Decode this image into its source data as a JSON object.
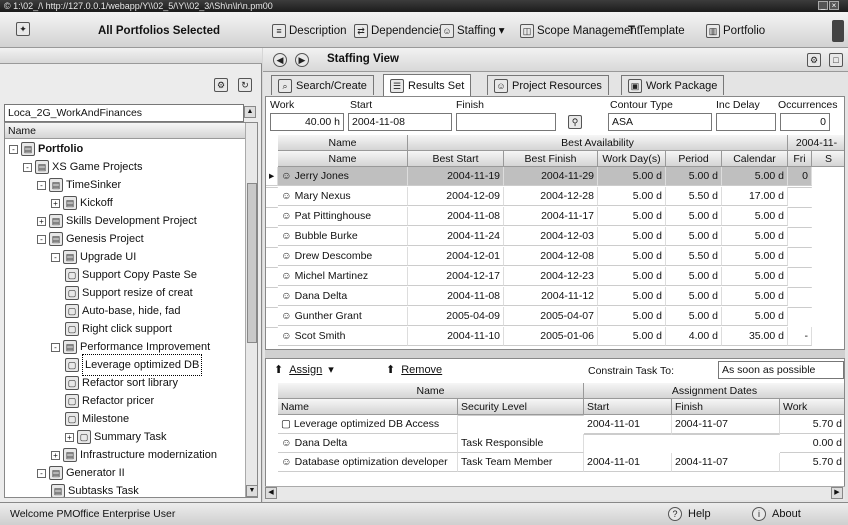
{
  "window": {
    "title": "© 1:\\02_/\\ http://127.0.0.1/webapp/Y\\\\02_5/\\Y\\\\02_3/\\Sh\\n\\lr\\n.pm00"
  },
  "toolbar": {
    "selection_label": "All Portfolios Selected",
    "items": [
      "Description",
      "Dependencies",
      "Staffing",
      "Scope Management",
      "Template",
      "Portfolio"
    ]
  },
  "left": {
    "location_value": "Loca_2G_WorkAndFinances",
    "column_header": "Name",
    "tree": [
      {
        "label": "Portfolio",
        "depth": 0,
        "expander": "-"
      },
      {
        "label": "XS Game Projects",
        "depth": 1,
        "expander": "-"
      },
      {
        "label": "TimeSinker",
        "depth": 2,
        "expander": "-"
      },
      {
        "label": "Kickoff",
        "depth": 3,
        "expander": "+"
      },
      {
        "label": "Skills Development Project",
        "depth": 2,
        "expander": "+"
      },
      {
        "label": "Genesis Project",
        "depth": 2,
        "expander": "-"
      },
      {
        "label": "Upgrade UI",
        "depth": 3,
        "expander": "-"
      },
      {
        "label": "Support Copy Paste Se",
        "depth": 4,
        "expander": ""
      },
      {
        "label": "Support resize of creat",
        "depth": 4,
        "expander": ""
      },
      {
        "label": "Auto-base, hide, fad",
        "depth": 4,
        "expander": ""
      },
      {
        "label": "Right click support",
        "depth": 4,
        "expander": ""
      },
      {
        "label": "Performance Improvement",
        "depth": 3,
        "expander": "-"
      },
      {
        "label": "Leverage optimized DB",
        "depth": 4,
        "expander": "",
        "selected": true
      },
      {
        "label": "Refactor sort library",
        "depth": 4,
        "expander": ""
      },
      {
        "label": "Refactor pricer",
        "depth": 4,
        "expander": ""
      },
      {
        "label": "Milestone",
        "depth": 4,
        "expander": ""
      },
      {
        "label": "Summary Task",
        "depth": 4,
        "expander": "+"
      },
      {
        "label": "Infrastructure modernization",
        "depth": 3,
        "expander": "+"
      },
      {
        "label": "Generator II",
        "depth": 2,
        "expander": "-"
      },
      {
        "label": "Subtasks Task",
        "depth": 3,
        "expander": ""
      }
    ]
  },
  "right": {
    "view_title": "Staffing View",
    "tabs": [
      "Search/Create",
      "Results Set",
      "Project Resources",
      "Work Package"
    ],
    "filters": {
      "work_label": "Work",
      "work_value": "40.00 h",
      "start_label": "Start",
      "start_value": "2004-11-08",
      "finish_label": "Finish",
      "finish_value": "",
      "contour_label": "Contour Type",
      "contour_value": "ASA",
      "inc_delay_label": "Inc Delay",
      "inc_delay_value": "",
      "occurrences_label": "Occurrences",
      "occurrences_value": "0"
    },
    "results": {
      "group_headers": [
        "Name",
        "Best Availability",
        "2004-11-"
      ],
      "columns": [
        "Name",
        "Best Start",
        "Best Finish",
        "Work Day(s)",
        "Period",
        "Calendar",
        "Fri",
        "S"
      ],
      "rows": [
        {
          "name": "Jerry Jones",
          "start": "2004-11-19",
          "finish": "2004-11-29",
          "work": "5.00 d",
          "period": "5.00 d",
          "calendar": "5.00 d",
          "fri": "0",
          "selected": true
        },
        {
          "name": "Mary Nexus",
          "start": "2004-12-09",
          "finish": "2004-12-28",
          "work": "5.00 d",
          "period": "5.50 d",
          "calendar": "17.00 d",
          "fri": ""
        },
        {
          "name": "Pat Pittinghouse",
          "start": "2004-11-08",
          "finish": "2004-11-17",
          "work": "5.00 d",
          "period": "5.00 d",
          "calendar": "5.00 d",
          "fri": ""
        },
        {
          "name": "Bubble Burke",
          "start": "2004-11-24",
          "finish": "2004-12-03",
          "work": "5.00 d",
          "period": "5.00 d",
          "calendar": "5.00 d",
          "fri": ""
        },
        {
          "name": "Drew Descombe",
          "start": "2004-12-01",
          "finish": "2004-12-08",
          "work": "5.00 d",
          "period": "5.50 d",
          "calendar": "5.00 d",
          "fri": ""
        },
        {
          "name": "Michel Martinez",
          "start": "2004-12-17",
          "finish": "2004-12-23",
          "work": "5.00 d",
          "period": "5.00 d",
          "calendar": "5.00 d",
          "fri": ""
        },
        {
          "name": "Dana Delta",
          "start": "2004-11-08",
          "finish": "2004-11-12",
          "work": "5.00 d",
          "period": "5.00 d",
          "calendar": "5.00 d",
          "fri": ""
        },
        {
          "name": "Gunther Grant",
          "start": "2005-04-09",
          "finish": "2005-04-07",
          "work": "5.00 d",
          "period": "5.00 d",
          "calendar": "5.00 d",
          "fri": ""
        },
        {
          "name": "Scot Smith",
          "start": "2004-11-10",
          "finish": "2005-01-06",
          "work": "5.00 d",
          "period": "4.00 d",
          "calendar": "35.00 d",
          "fri": "-"
        }
      ]
    },
    "assign": {
      "assign_label": "Assign",
      "remove_label": "Remove",
      "constrain_label": "Constrain Task To:",
      "constrain_value": "As soon as possible",
      "group_headers": [
        "Name",
        "Assignment Dates"
      ],
      "columns": [
        "Name",
        "Security Level",
        "Start",
        "Finish",
        "Work"
      ],
      "rows": [
        {
          "name": "Leverage optimized DB Access",
          "security": "",
          "start": "2004-11-01",
          "finish": "2004-11-07",
          "work": "5.70 d",
          "kind": "task"
        },
        {
          "name": "Dana Delta",
          "security": "Task Responsible",
          "start": "",
          "finish": "",
          "work": "0.00 d",
          "kind": "person"
        },
        {
          "name": "Database optimization developer",
          "security": "Task Team Member",
          "start": "2004-11-01",
          "finish": "2004-11-07",
          "work": "5.70 d",
          "kind": "person"
        }
      ]
    }
  },
  "status": {
    "text": "Welcome PMOffice Enterprise User",
    "help": "Help",
    "about": "About"
  }
}
